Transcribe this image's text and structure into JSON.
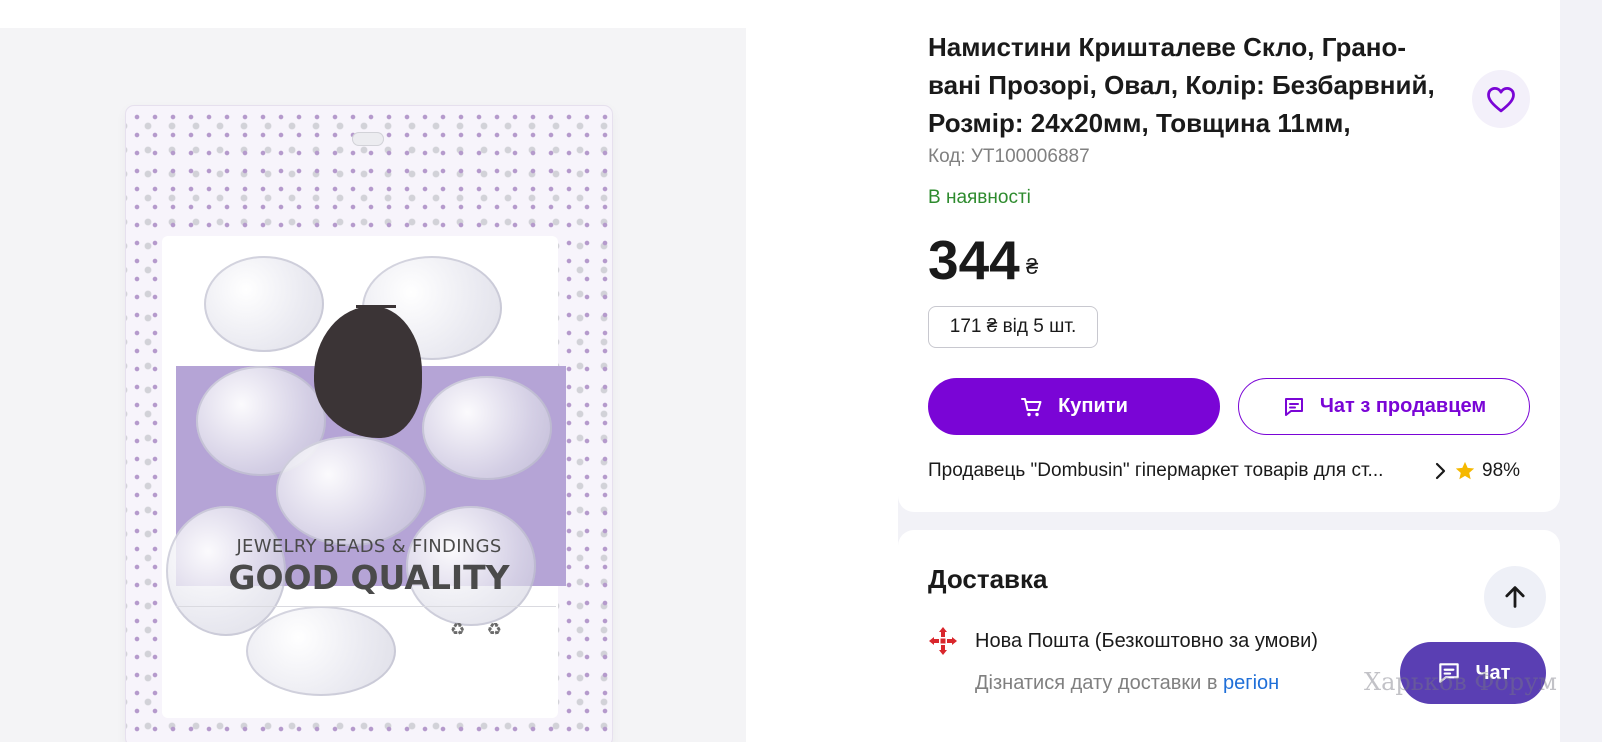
{
  "product": {
    "title": "Намистини Кришталеве Скло, Грано-вані Прозорі, Овал, Колір: Безбарвний, Розмір: 24х20мм, Товщина 11мм,",
    "code": "Код: УТ100006887",
    "stock_status": "В наявності",
    "price": "344",
    "currency": "₴",
    "wholesale_price": "171 ₴ від 5 шт.",
    "image": {
      "text_line_1": "JEWELRY BEADS & FINDINGS",
      "text_line_2": "GOOD QUALITY"
    }
  },
  "actions": {
    "buy_label": "Купити",
    "chat_seller_label": "Чат з продавцем"
  },
  "seller": {
    "name": "Продавець \"Dombusin\" гіпермаркет товарів для ст...",
    "rating": "98%"
  },
  "delivery": {
    "title": "Доставка",
    "carrier": "Нова Пошта (Безкоштовно за умови)",
    "date_prefix": "Дізнатися дату доставки в ",
    "date_link": "регіон"
  },
  "chat_widget": {
    "label": "Чат"
  },
  "watermark": "Харьков Форум",
  "colors": {
    "accent": "#7a05d6",
    "in_stock": "#2e8b2e",
    "link": "#1f6fd8",
    "chat_widget": "#5a3fb3",
    "rating_star": "#f5b800",
    "nova_poshta": "#d9262c"
  },
  "icons": {
    "favorite": "heart-icon",
    "buy": "cart-icon",
    "chat_seller": "chat-icon",
    "seller_more": "chevron-right-icon",
    "rating": "star-icon",
    "carrier": "nova-poshta-icon",
    "scroll_top": "arrow-up-icon",
    "chat_widget": "chat-icon"
  }
}
